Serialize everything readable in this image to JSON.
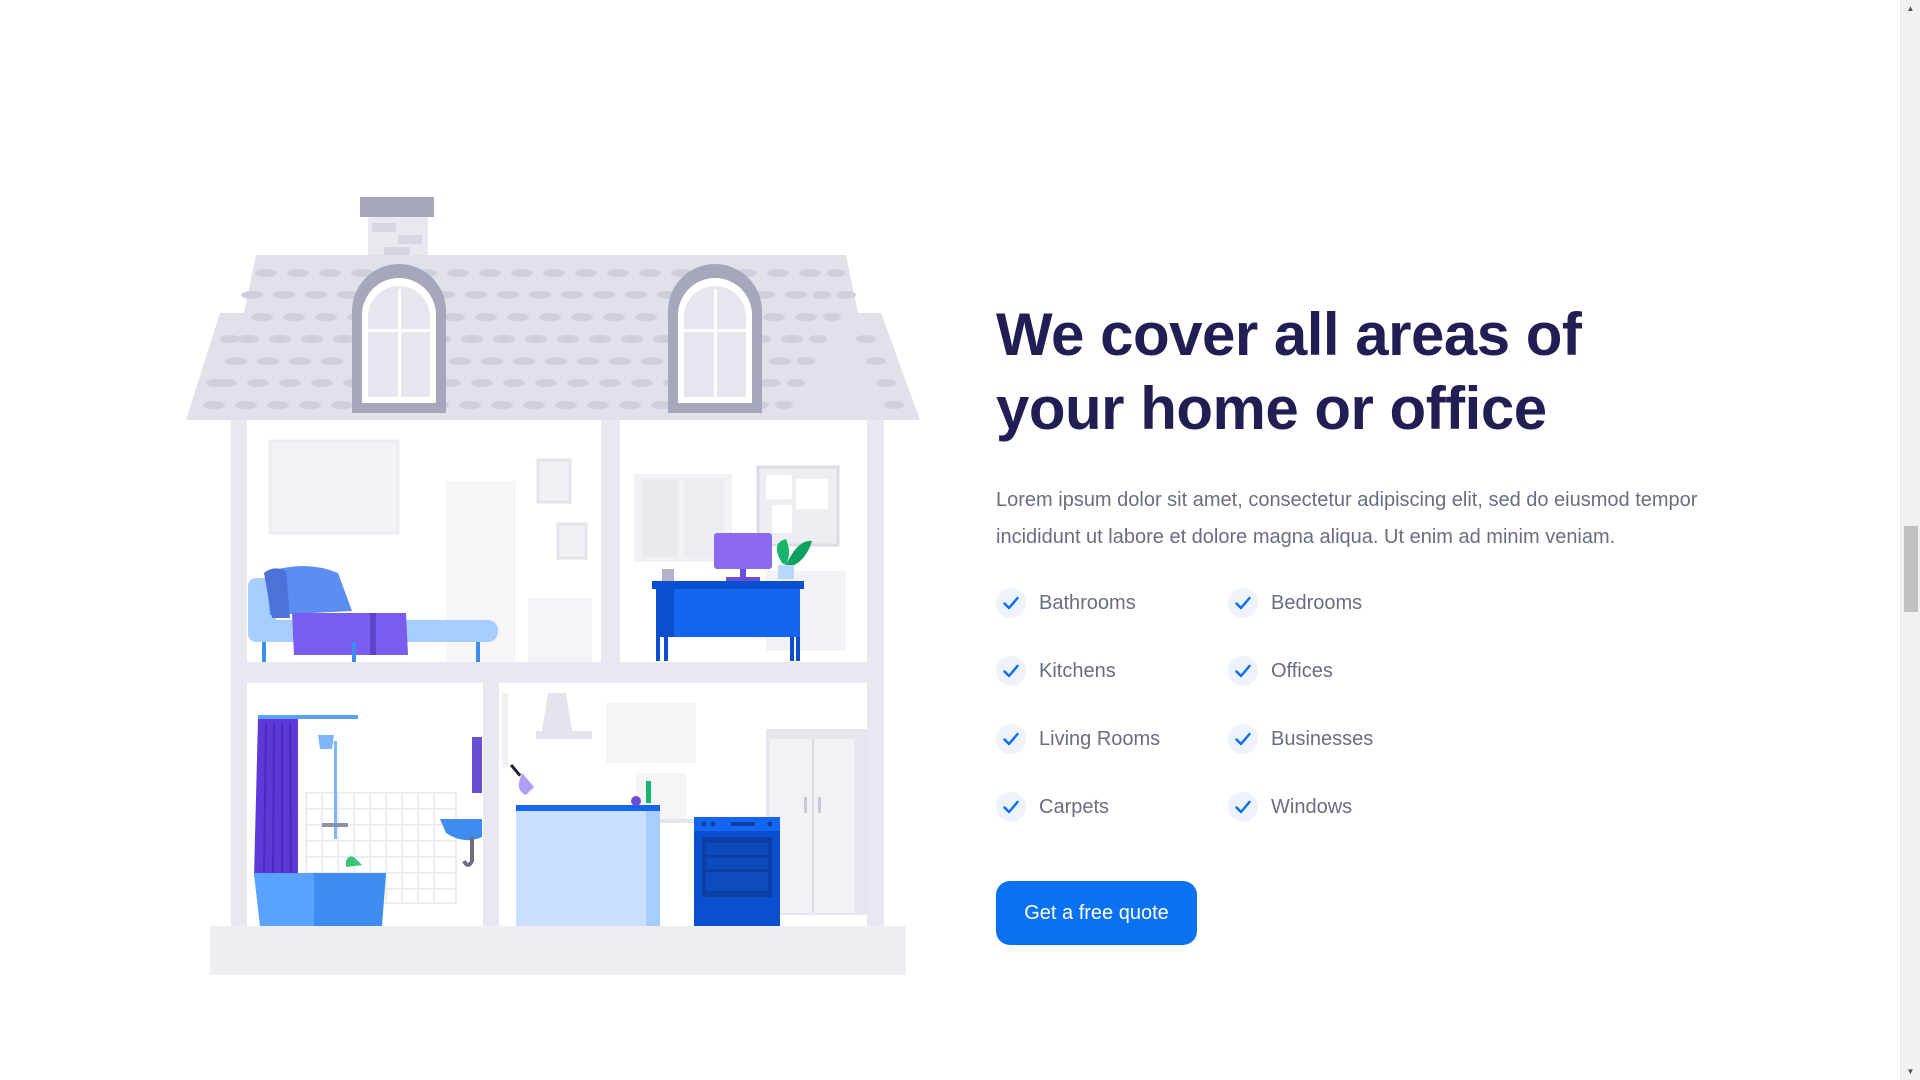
{
  "section": {
    "headline": "We cover all areas of your home or office",
    "lede": "Lorem ipsum dolor sit amet, consectetur adipiscing elit, sed do eiusmod tempor incididunt ut labore et dolore magna aliqua. Ut enim ad minim veniam.",
    "features": [
      "Bathrooms",
      "Bedrooms",
      "Kitchens",
      "Offices",
      "Living Rooms",
      "Businesses",
      "Carpets",
      "Windows"
    ],
    "cta_label": "Get a free quote"
  },
  "illustration": {
    "icon": "house-cutaway-illustration"
  },
  "colors": {
    "heading": "#201e52",
    "body_text": "#6a6c84",
    "accent": "#0a72f0",
    "check_background": "#eef2fb",
    "check_mark": "#0a72f0"
  },
  "scrollbar": {
    "position_fraction": 0.53
  }
}
